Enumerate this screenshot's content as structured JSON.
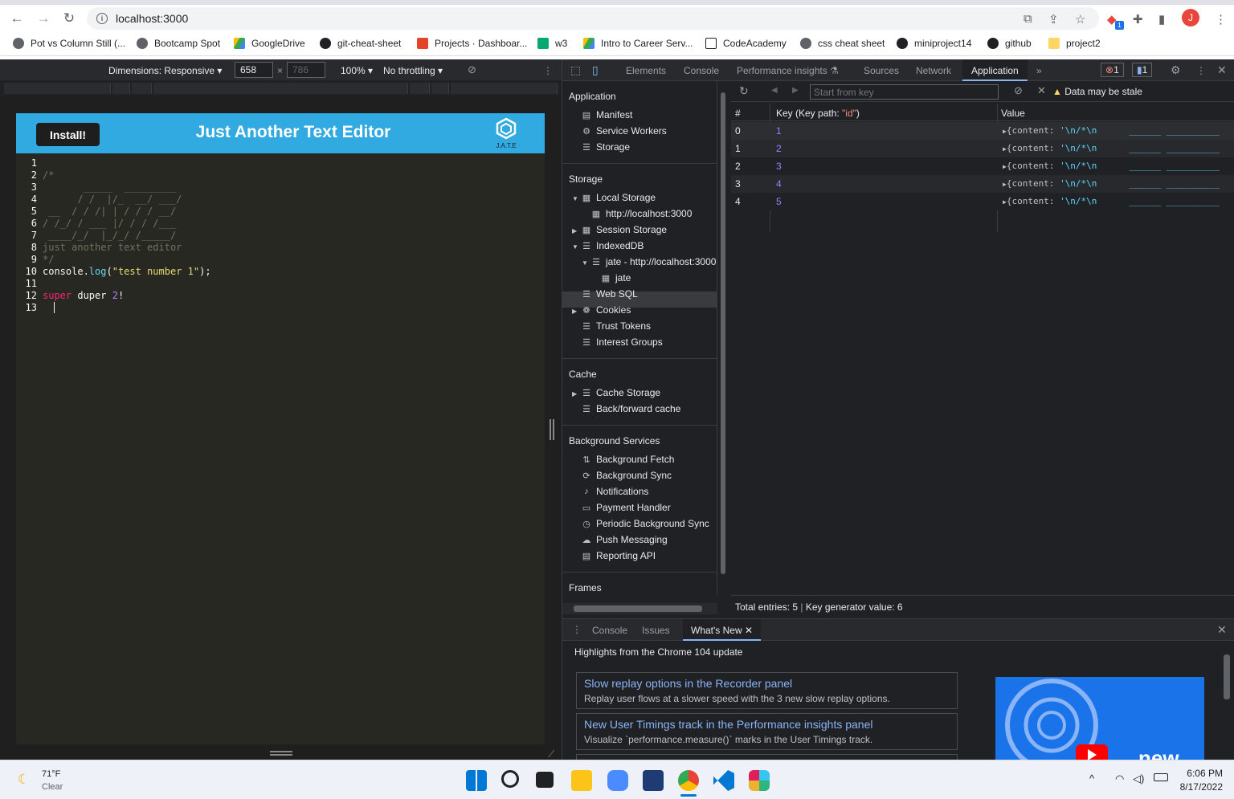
{
  "browser": {
    "url": "localhost:3000",
    "bookmarks": [
      "Pot vs Column Still (...",
      "Bootcamp Spot",
      "GoogleDrive",
      "git-cheat-sheet",
      "Projects · Dashboar...",
      "w3",
      "Intro to Career Serv...",
      "CodeAcademy",
      "css cheat sheet",
      "miniproject14",
      "github",
      "project2"
    ],
    "avatar_letter": "J",
    "extension_badge": "1"
  },
  "device_toolbar": {
    "dimensions_label": "Dimensions: Responsive",
    "width": "658",
    "height": "786",
    "zoom": "100%",
    "throttle": "No throttling",
    "times": "×"
  },
  "app": {
    "install_label": "Install!",
    "title": "Just Another Text Editor",
    "logo_text": "J.A.T.E",
    "editor_lines": [
      {
        "n": "1",
        "html": ""
      },
      {
        "n": "2",
        "html": "<span class=\"cm\">/*</span>"
      },
      {
        "n": "3",
        "html": "<span class=\"cm\">       _____  _________</span>"
      },
      {
        "n": "4",
        "html": "<span class=\"cm\">      / /  |/_  __/ ___/</span>"
      },
      {
        "n": "5",
        "html": "<span class=\"cm\"> __  / / /| | / / / __/</span>"
      },
      {
        "n": "6",
        "html": "<span class=\"cm\">/ /_/ / ___ |/ / / /___</span>"
      },
      {
        "n": "7",
        "html": "<span class=\"cm\"> ____/_/  |_/_/ /_____/</span>"
      },
      {
        "n": "8",
        "html": "<span class=\"cm\">just another text editor</span>"
      },
      {
        "n": "9",
        "html": "<span class=\"cm\">*/</span>"
      },
      {
        "n": "10",
        "html": "console.<span class=\"fn\">log</span>(<span class=\"str\">\"test number 1\"</span>);"
      },
      {
        "n": "11",
        "html": ""
      },
      {
        "n": "12",
        "html": "<span class=\"kw\">super</span> duper <span class=\"num\">2</span>!"
      },
      {
        "n": "13",
        "html": "  <span style=\"border-left:1px solid #f8f8f2\">&nbsp;</span>"
      }
    ]
  },
  "devtools": {
    "tabs": [
      "Elements",
      "Console",
      "Performance insights",
      "Sources",
      "Network",
      "Application"
    ],
    "active_tab": "Application",
    "errors_count": "1",
    "messages_count": "1",
    "sidebar": {
      "application_header": "Application",
      "application_items": [
        "Manifest",
        "Service Workers",
        "Storage"
      ],
      "storage_header": "Storage",
      "storage_items": [
        "Local Storage",
        "http://localhost:3000",
        "Session Storage",
        "IndexedDB",
        "jate - http://localhost:3000",
        "jate",
        "Web SQL",
        "Cookies",
        "Trust Tokens",
        "Interest Groups"
      ],
      "cache_header": "Cache",
      "cache_items": [
        "Cache Storage",
        "Back/forward cache"
      ],
      "bg_header": "Background Services",
      "bg_items": [
        "Background Fetch",
        "Background Sync",
        "Notifications",
        "Payment Handler",
        "Periodic Background Sync",
        "Push Messaging",
        "Reporting API"
      ],
      "frames_header": "Frames"
    },
    "db": {
      "start_key_placeholder": "Start from key",
      "stale_warning": "Data may be stale",
      "columns": [
        "#",
        "Key (Key path: \"id\")",
        "Value"
      ],
      "key_path_label": "Key (Key path: ",
      "key_path": "\"id\"",
      "rows": [
        {
          "idx": "0",
          "key": "1",
          "value": "{content: '\\n/*\\n"
        },
        {
          "idx": "1",
          "key": "2",
          "value": "{content: '\\n/*\\n"
        },
        {
          "idx": "2",
          "key": "3",
          "value": "{content: '\\n/*\\n"
        },
        {
          "idx": "3",
          "key": "4",
          "value": "{content: '\\n/*\\n"
        },
        {
          "idx": "4",
          "key": "5",
          "value": "{content: '\\n/*\\n"
        }
      ],
      "total_entries": "Total entries: 5",
      "key_generator": "Key generator value: 6"
    },
    "drawer": {
      "tabs": [
        "Console",
        "Issues",
        "What's New"
      ],
      "active_tab": "What's New",
      "highlight": "Highlights from the Chrome 104 update",
      "cards": [
        {
          "title": "Slow replay options in the Recorder panel",
          "desc": "Replay user flows at a slower speed with the 3 new slow replay options."
        },
        {
          "title": "New User Timings track in the Performance insights panel",
          "desc": "Visualize `performance.measure()` marks in the User Timings track."
        }
      ],
      "video_text": "new"
    }
  },
  "taskbar": {
    "temp": "71°F",
    "weather": "Clear",
    "time": "6:06 PM",
    "date": "8/17/2022"
  },
  "colors": {
    "app_header": "#31a9e1",
    "editor_bg": "#272822",
    "devtools_bg": "#202124",
    "link_blue": "#8ab4f8"
  }
}
